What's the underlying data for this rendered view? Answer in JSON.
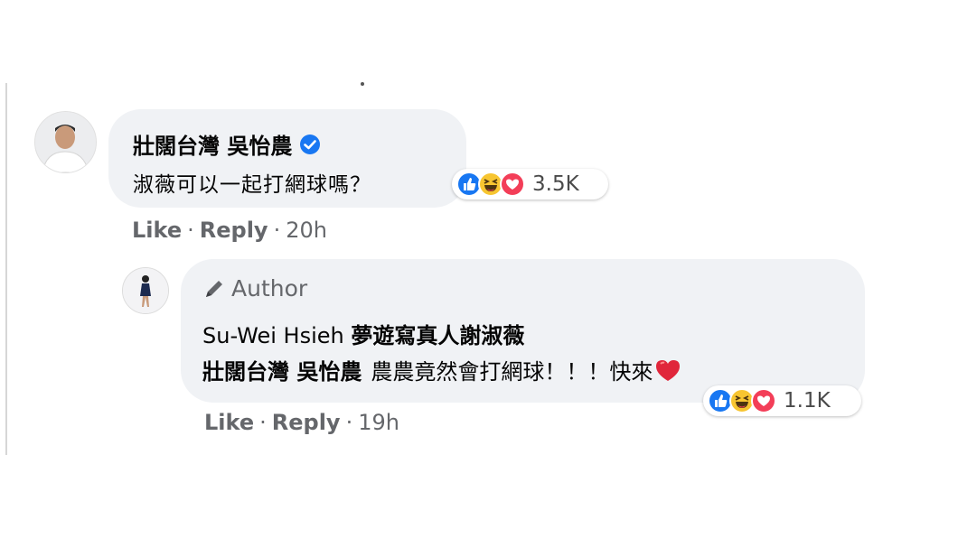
{
  "comment": {
    "author_name": "壯闊台灣 吳怡農",
    "verified_icon": "verified-badge-icon",
    "text": "淑薇可以一起打網球嗎？",
    "reaction_count": "3.5K",
    "reactions": [
      "like-icon",
      "haha-icon",
      "care-icon"
    ],
    "actions": {
      "like": "Like",
      "reply": "Reply",
      "sep": "·",
      "time": "20h"
    }
  },
  "reply": {
    "badge": "Author",
    "author_name": "Su-Wei Hsieh",
    "author_page": "夢遊寫真人謝淑薇",
    "mention": "壯闊台灣 吳怡農",
    "text": "農農竟然會打網球！！！快來",
    "reaction_count": "1.1K",
    "reactions": [
      "like-icon",
      "haha-icon",
      "care-icon"
    ],
    "actions": {
      "like": "Like",
      "reply": "Reply",
      "sep": "·",
      "time": "19h"
    }
  },
  "colors": {
    "like_blue": "#1877f2",
    "haha_yellow": "#f7c531",
    "care_red": "#f33e58",
    "bubble": "#f0f2f5",
    "secondary_text": "#65676b"
  }
}
